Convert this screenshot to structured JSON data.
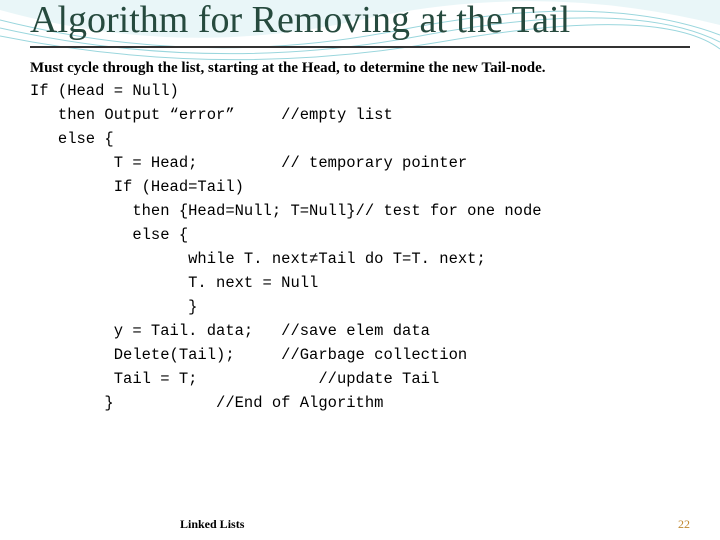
{
  "title": "Algorithm for Removing at the Tail",
  "intro": "Must cycle through the list, starting at the Head, to determine the new Tail-node.",
  "code": "If (Head = Null)\n   then Output “error”     //empty list\n   else {\n         T = Head;         // temporary pointer\n         If (Head=Tail)\n           then {Head=Null; T=Null}// test for one node\n           else {\n                 while T. next≠Tail do T=T. next;\n                 T. next = Null\n                 }\n         y = Tail. data;   //save elem data\n         Delete(Tail);     //Garbage collection\n         Tail = T;             //update Tail\n        }           //End of Algorithm",
  "footer": {
    "label": "Linked Lists",
    "page": "22"
  }
}
